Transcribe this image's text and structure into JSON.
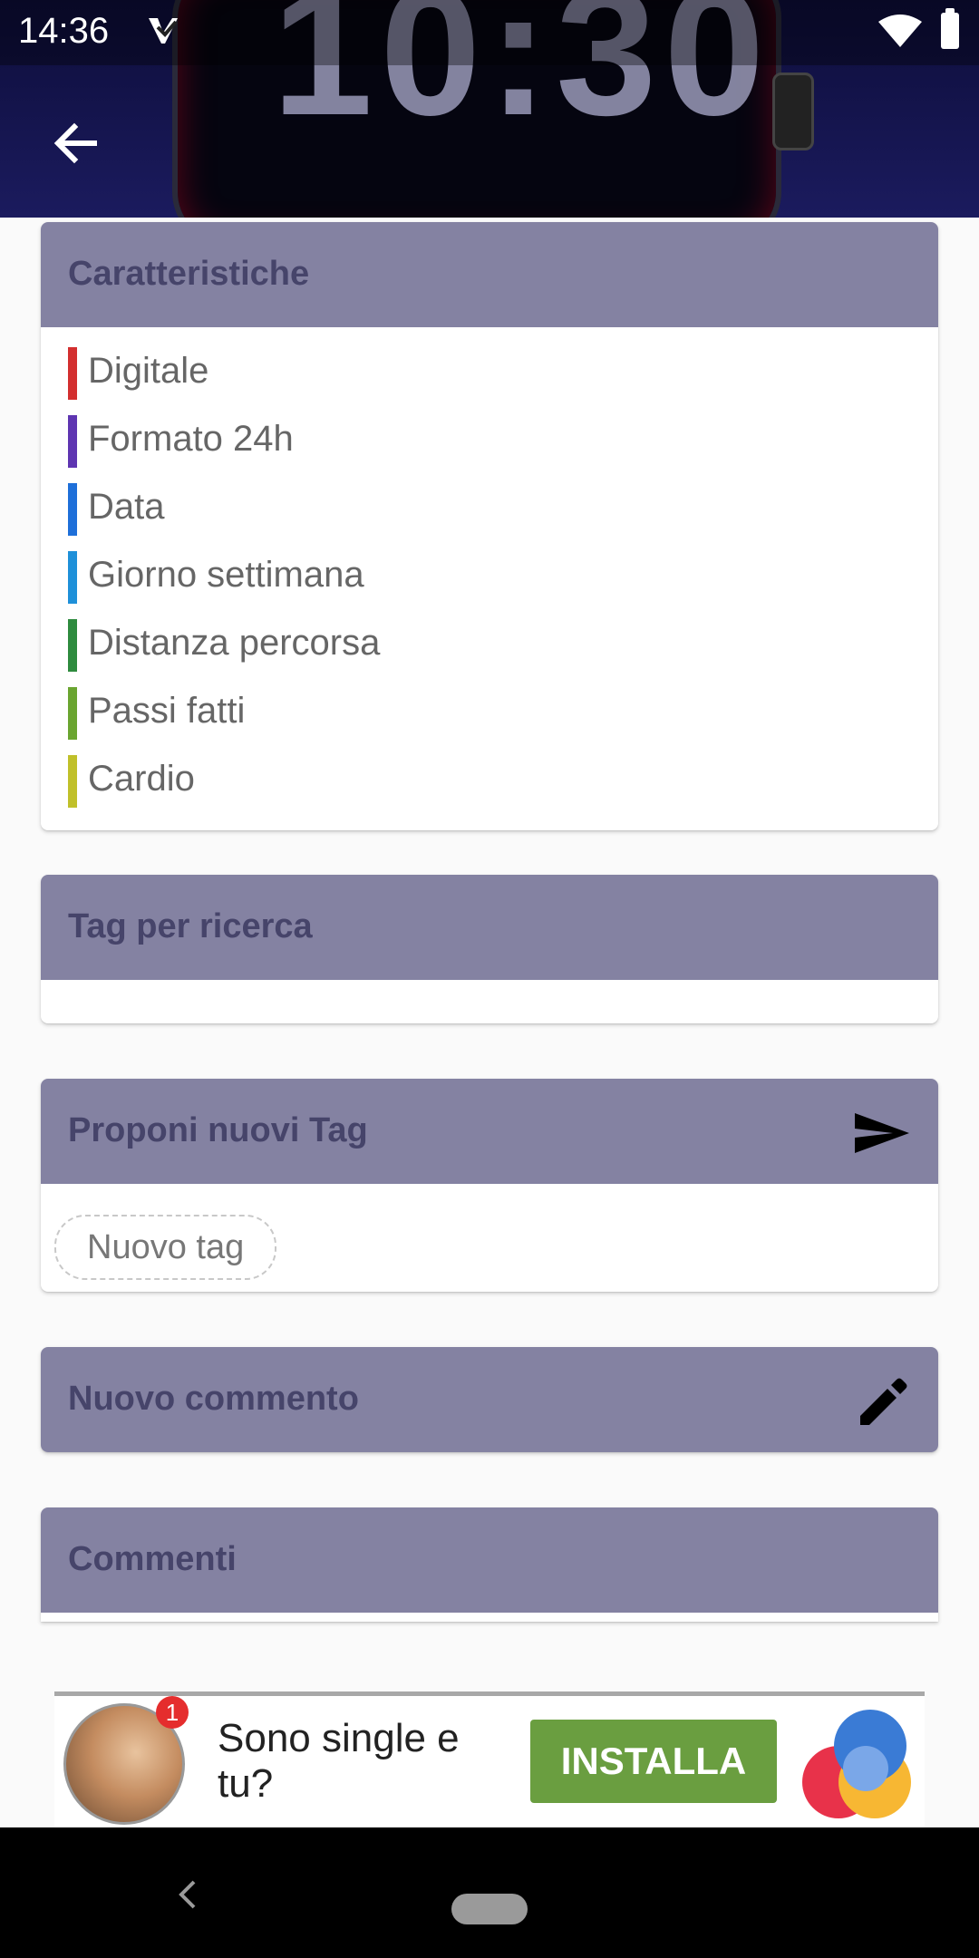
{
  "status_bar": {
    "time": "14:36",
    "icons": [
      "app-notification-icon",
      "wifi-icon",
      "battery-icon"
    ]
  },
  "header": {
    "background_watch_time": "10:30",
    "back_icon": "arrow-back-icon"
  },
  "features_card": {
    "title": "Caratteristiche",
    "items": [
      {
        "label": "Digitale",
        "color": "#d32f2f"
      },
      {
        "label": "Formato 24h",
        "color": "#5e35b1"
      },
      {
        "label": "Data",
        "color": "#1e6fd9"
      },
      {
        "label": "Giorno settimana",
        "color": "#1e90d9"
      },
      {
        "label": "Distanza percorsa",
        "color": "#2e8b3e"
      },
      {
        "label": "Passi fatti",
        "color": "#6aa530"
      },
      {
        "label": "Cardio",
        "color": "#c0c02a"
      }
    ]
  },
  "tags_card": {
    "title": "Tag per ricerca"
  },
  "propose_card": {
    "title": "Proponi nuovi Tag",
    "send_icon": "send-icon",
    "chip_label": "Nuovo tag"
  },
  "comment_card": {
    "title": "Nuovo commento",
    "edit_icon": "pencil-icon"
  },
  "comments_card": {
    "title": "Commenti"
  },
  "ad": {
    "badge": "1",
    "text": "Sono single e tu?",
    "button": "INSTALLA"
  },
  "colors": {
    "header": "#8482a2",
    "title": "#46446a",
    "install": "#6a9e40"
  }
}
